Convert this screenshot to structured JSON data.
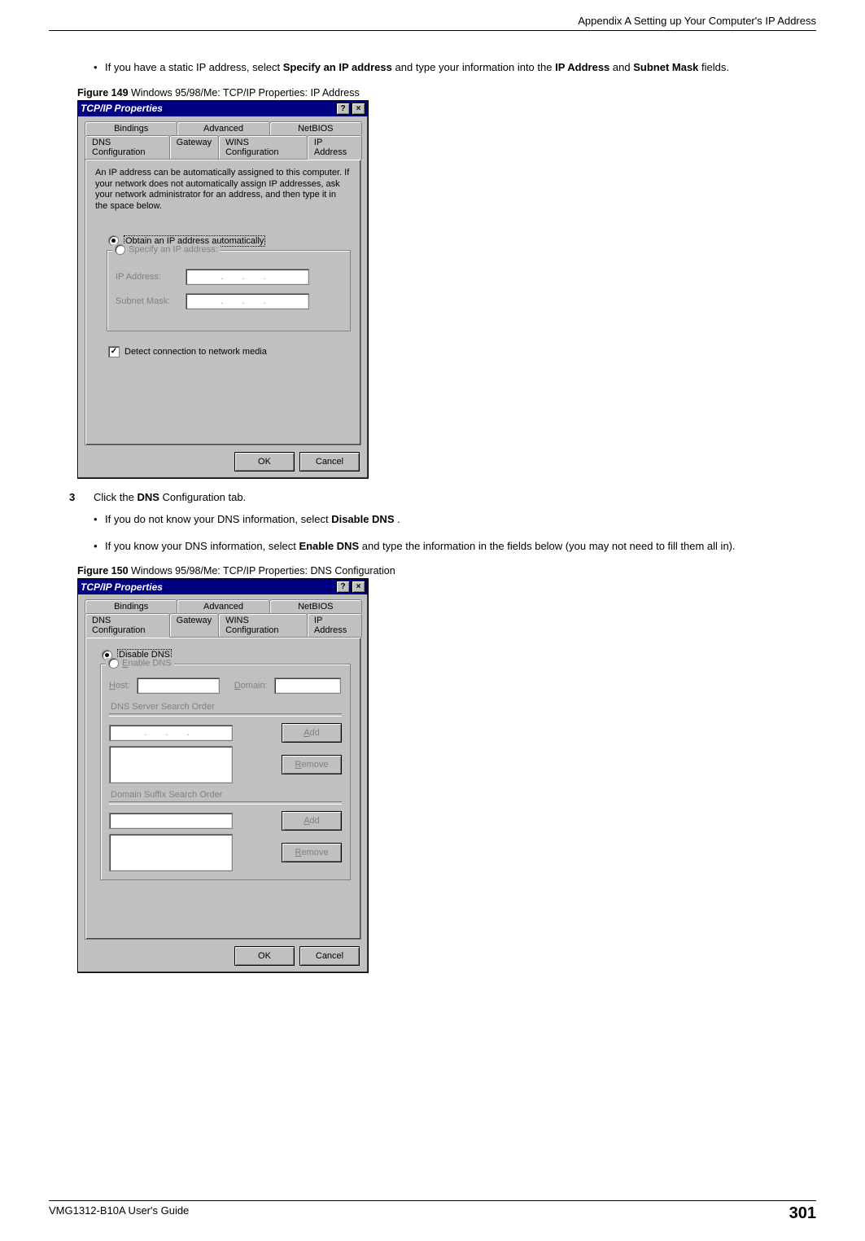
{
  "header": {
    "appendix_title": "Appendix A Setting up Your Computer's IP Address"
  },
  "body": {
    "bullet1_pre": "If you have a static IP address, select ",
    "bullet1_bold1": "Specify an IP address",
    "bullet1_mid": " and type your information into the ",
    "bullet1_bold2": "IP Address",
    "bullet1_and": " and ",
    "bullet1_bold3": "Subnet Mask",
    "bullet1_post": " fields.",
    "fig149_num": "Figure 149",
    "fig149_cap": "   Windows 95/98/Me: TCP/IP Properties: IP Address",
    "step3_num": "3",
    "step3_pre": "Click the ",
    "step3_bold": "DNS",
    "step3_post": " Configuration tab.",
    "bullet2_pre": "If you do not know your DNS information, select ",
    "bullet2_bold": "Disable DNS",
    "bullet2_post": ".",
    "bullet3_pre": "If you know your DNS information, select ",
    "bullet3_bold": "Enable DNS",
    "bullet3_post": " and type the information in the fields below (you may not need to fill them all in).",
    "fig150_num": "Figure 150",
    "fig150_cap": "   Windows 95/98/Me: TCP/IP Properties: DNS Configuration"
  },
  "dlg": {
    "title": "TCP/IP Properties",
    "help": "?",
    "close": "×",
    "tabs_row1": {
      "bindings": "Bindings",
      "advanced": "Advanced",
      "netbios": "NetBIOS"
    },
    "tabs_row2": {
      "dns": "DNS Configuration",
      "gateway": "Gateway",
      "wins": "WINS Configuration",
      "ip": "IP Address"
    },
    "ip_info": "An IP address can be automatically assigned to this computer. If your network does not automatically assign IP addresses, ask your network administrator for an address, and then type it in the space below.",
    "radio_obtain": "Obtain an IP address automatically",
    "radio_specify": "Specify an IP address:",
    "lbl_ip": "IP Address:",
    "lbl_mask": "Subnet Mask:",
    "ip_dots": ".   .   .",
    "chk_detect": "Detect connection to network media",
    "ok": "OK",
    "cancel": "Cancel",
    "radio_disable_dns_pre": "D",
    "radio_disable_dns": "isable DNS",
    "radio_enable_dns_pre": "E",
    "radio_enable_dns": "nable DNS",
    "lbl_host_pre": "H",
    "lbl_host": "ost:",
    "lbl_domain_pre": "D",
    "lbl_domain": "omain:",
    "grp_dns_order": "DNS Server Search Order",
    "grp_suffix": "Domain Suffix Search Order",
    "btn_add_pre": "A",
    "btn_add": "dd",
    "btn_remove_pre": "R",
    "btn_remove": "emove",
    "checkmark": "✓"
  },
  "footer": {
    "guide": "VMG1312-B10A User's Guide",
    "page": "301"
  }
}
